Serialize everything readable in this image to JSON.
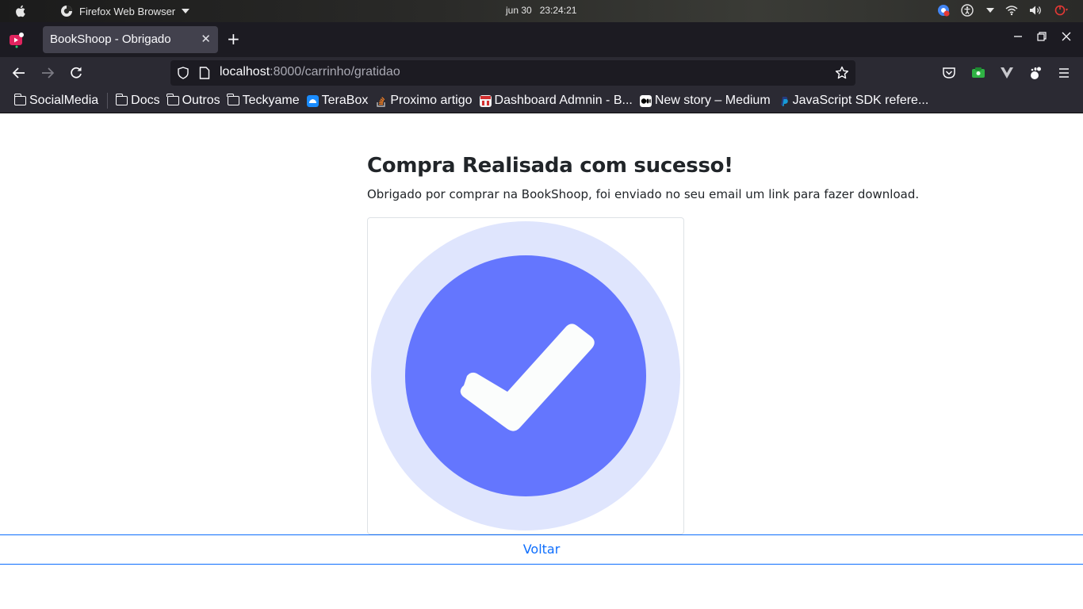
{
  "os": {
    "app_name": "Firefox Web Browser",
    "date": "jun 30",
    "time": "23:24:21"
  },
  "browser": {
    "tab_title": "BookShoop - Obrigado",
    "url_host": "localhost",
    "url_rest": ":8000/carrinho/gratidao"
  },
  "bookmarks": [
    {
      "label": "SocialMedia",
      "icon": "folder-icon"
    },
    {
      "label": "Docs",
      "icon": "folder-icon"
    },
    {
      "label": "Outros",
      "icon": "folder-icon"
    },
    {
      "label": "Teckyame",
      "icon": "folder-icon"
    },
    {
      "label": "TeraBox",
      "icon": "terabox-icon"
    },
    {
      "label": "Proximo artigo",
      "icon": "stackoverflow-icon"
    },
    {
      "label": "Dashboard Admnin - B...",
      "icon": "dashboard-icon"
    },
    {
      "label": "New story – Medium",
      "icon": "medium-icon"
    },
    {
      "label": "JavaScript SDK refere...",
      "icon": "paypal-icon"
    }
  ],
  "page": {
    "heading": "Compra Realisada com sucesso!",
    "message": "Obrigado por comprar na BookShoop, foi enviado no seu email um link para fazer download.",
    "back_link": "Voltar"
  },
  "colors": {
    "accent": "#0d6efd",
    "check_circle": "#6476fe",
    "check_halo": "#dfe5fd"
  }
}
